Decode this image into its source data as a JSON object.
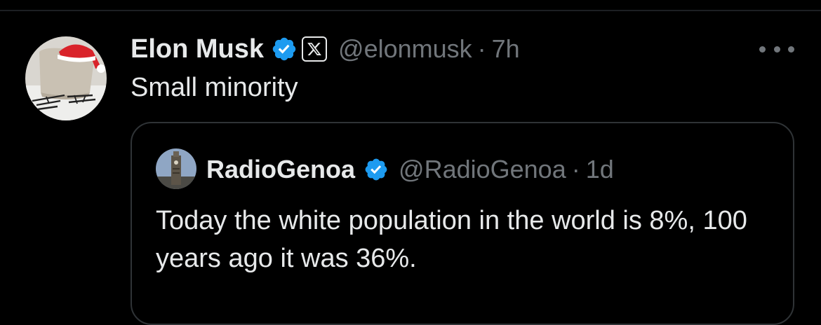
{
  "tweet": {
    "author_name": "Elon Musk",
    "handle": "@elonmusk",
    "separator": "·",
    "time": "7h",
    "text": "Small minority",
    "icons": {
      "verified": "verified-badge-icon",
      "affiliation": "x-logo-icon",
      "more": "more-options-icon"
    }
  },
  "quote": {
    "author_name": "RadioGenoa",
    "handle": "@RadioGenoa",
    "separator": "·",
    "time": "1d",
    "text": "Today the white population in the world is 8%, 100 years ago it was 36%."
  },
  "colors": {
    "background": "#000000",
    "primary_text": "#e7e9ea",
    "secondary_text": "#71767b",
    "verified_blue": "#1d9bf0",
    "border": "#2f3336"
  }
}
